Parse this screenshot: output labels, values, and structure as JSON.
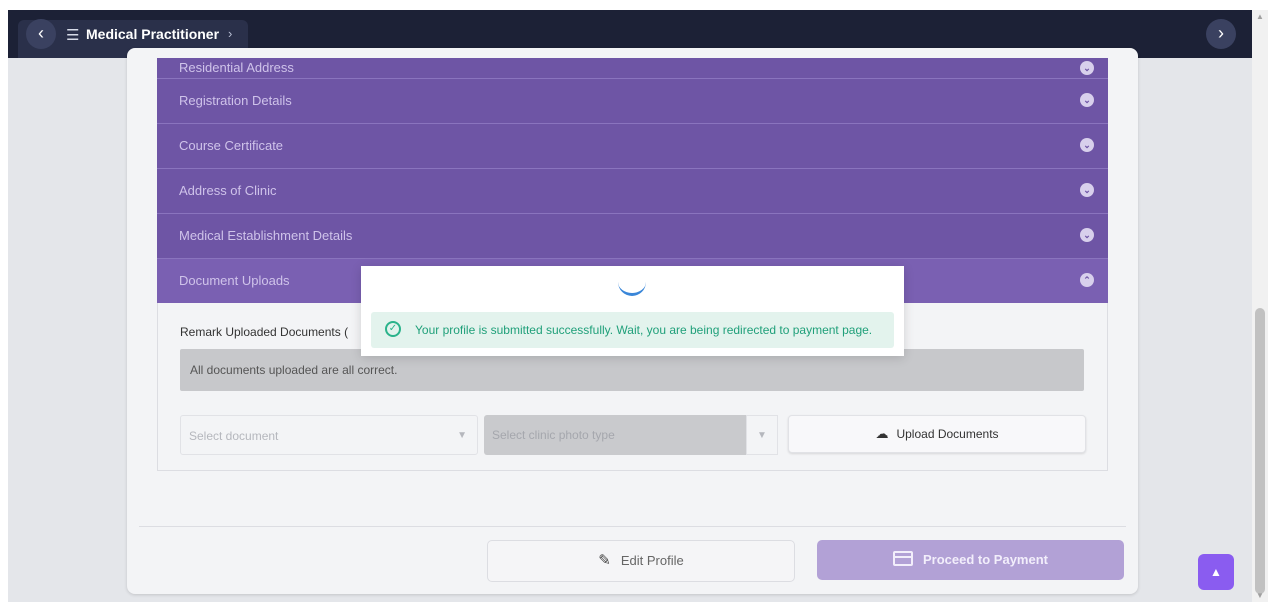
{
  "nav": {
    "title": "Medical Practitioner",
    "back_icon": "chevron-left-icon",
    "forward_icon": "chevron-right-icon",
    "menu_icon": "list-icon"
  },
  "accordion": {
    "sections": [
      {
        "label": "Residential Address",
        "state": "collapsed"
      },
      {
        "label": "Registration Details",
        "state": "collapsed"
      },
      {
        "label": "Course Certificate",
        "state": "collapsed"
      },
      {
        "label": "Address of Clinic",
        "state": "collapsed"
      },
      {
        "label": "Medical Establishment Details",
        "state": "collapsed"
      },
      {
        "label": "Document Uploads",
        "state": "expanded"
      }
    ]
  },
  "documents": {
    "remark_label": "Remark Uploaded Documents (",
    "remark_text": "All documents uploaded are all correct.",
    "select_document_placeholder": "Select document",
    "select_photo_placeholder": "Select clinic photo type",
    "upload_label": "Upload Documents"
  },
  "actions": {
    "edit_label": "Edit Profile",
    "pay_label": "Proceed to Payment"
  },
  "modal": {
    "message": "Your profile is submitted successfully. Wait, you are being redirected to payment page."
  },
  "colors": {
    "accordion": "#6e55a5",
    "success": "#20a07a",
    "primary": "#8a5cf0"
  }
}
